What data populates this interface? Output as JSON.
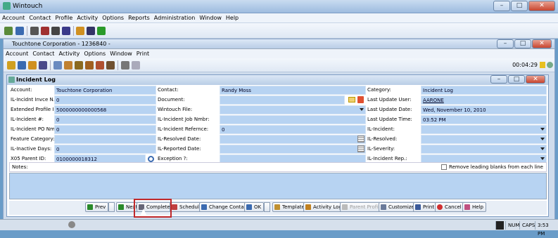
{
  "app": {
    "title": "Wintouch"
  },
  "menu": [
    "Account",
    "Contact",
    "Profile",
    "Activity",
    "Options",
    "Reports",
    "Administration",
    "Window",
    "Help"
  ],
  "account_window": {
    "title": "Touchtone Corporation - 1236840 -",
    "menu": [
      "Account",
      "Contact",
      "Activity",
      "Options",
      "Window",
      "Print"
    ],
    "timer": "00:04:29"
  },
  "incident": {
    "title": "Incident Log",
    "rows": [
      [
        {
          "label": "Account:",
          "value": "Touchtone Corporation"
        },
        {
          "label": "Contact:",
          "value": "Randy Moss"
        },
        {
          "label": "Category:",
          "value": "Incident Log"
        }
      ],
      [
        {
          "label": "IL-Incidnt Invce N...",
          "value": "0"
        },
        {
          "label": "Document:",
          "value": ""
        },
        {
          "label": "Last Update User:",
          "value": "AARONE"
        }
      ],
      [
        {
          "label": "Extended Profile ID:",
          "value": "5000000000000568"
        },
        {
          "label": "Wintouch File:",
          "value": ""
        },
        {
          "label": "Last Update Date:",
          "value": "Wed, November 10, 2010"
        }
      ],
      [
        {
          "label": "IL-Incident #:",
          "value": "0"
        },
        {
          "label": "IL-Incident Job Nmbr:",
          "value": ""
        },
        {
          "label": "Last Update Time:",
          "value": "03:52 PM"
        }
      ],
      [
        {
          "label": "IL-Incident PO Nm...",
          "value": "0"
        },
        {
          "label": "IL-Incident Refernce:",
          "value": "0"
        },
        {
          "label": "IL-Incident:",
          "value": ""
        }
      ],
      [
        {
          "label": "Feature Category:",
          "value": ""
        },
        {
          "label": "IL-Resolved Date:",
          "value": ""
        },
        {
          "label": "IL-Resolved:",
          "value": ""
        }
      ],
      [
        {
          "label": "IL-Inactive Days:",
          "value": "0"
        },
        {
          "label": "IL-Reported Date:",
          "value": ""
        },
        {
          "label": "IL-Severity:",
          "value": ""
        }
      ],
      [
        {
          "label": "X05 Parent ID:",
          "value": "0100000018312"
        },
        {
          "label": "Exception       ?:",
          "value": ""
        },
        {
          "label": "IL-Incident Rep.:",
          "value": ""
        }
      ]
    ],
    "notes_label": "Notes:",
    "remove_blanks_label": "Remove leading blanks from each line"
  },
  "buttons": {
    "prev": "Prev",
    "next": "Next",
    "complete": "Complete",
    "schedule": "Schedule",
    "change_contact": "Change Contact",
    "ok": "OK",
    "template": "Template",
    "activity_log": "Activity Log",
    "parent_profile": "Parent Profile",
    "customize": "Customize",
    "print": "Print",
    "cancel": "Cancel",
    "help": "Help"
  },
  "status": {
    "num": "NUM",
    "caps": "CAPS",
    "time": "3:53 PM"
  },
  "colors": {
    "field_bg": "#b7d3f2",
    "highlight": "#c0282a"
  }
}
